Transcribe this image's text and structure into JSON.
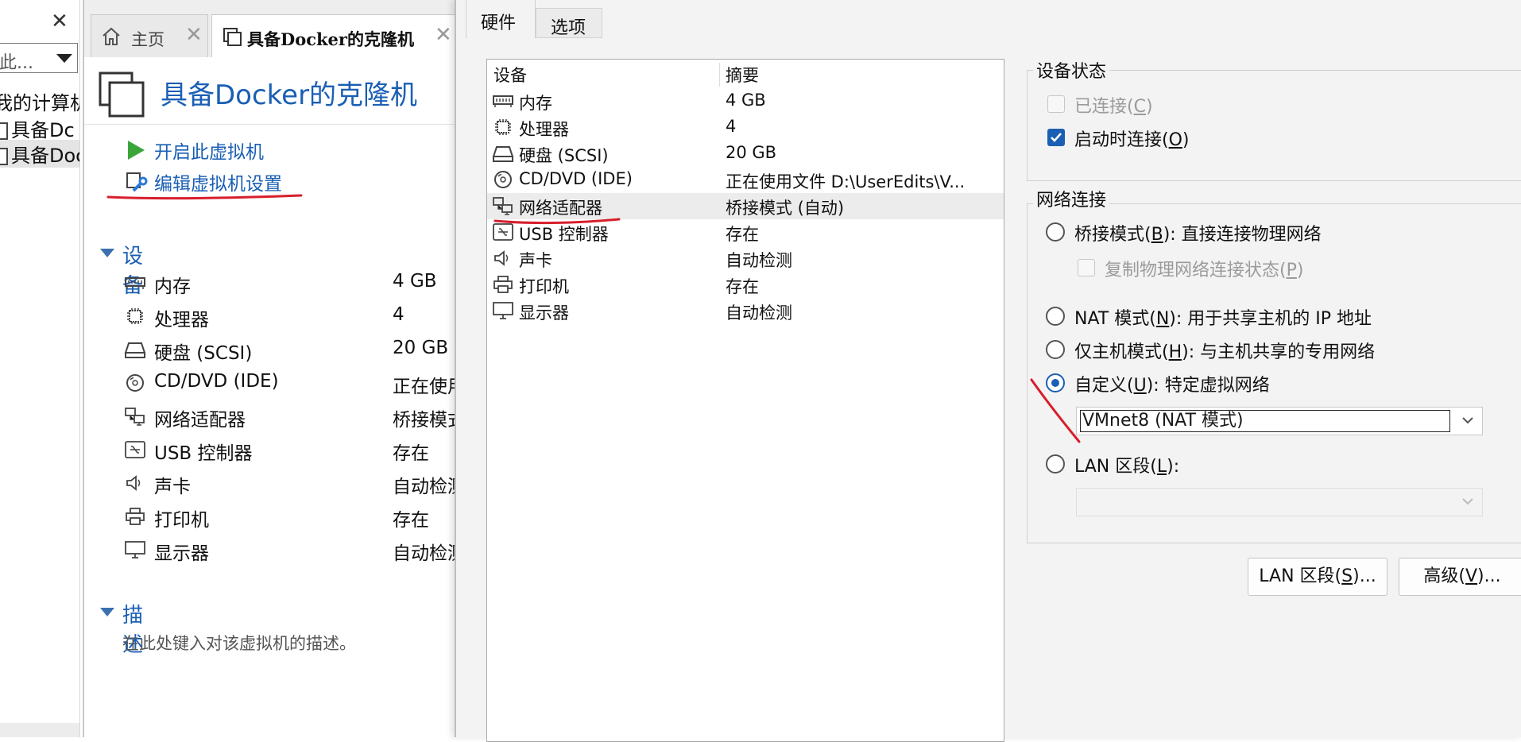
{
  "library": {
    "search_text": "此...",
    "root_label": "我的计算机",
    "items": [
      "具备Dc",
      "具备Doc"
    ]
  },
  "tabs": [
    {
      "label": "主页"
    },
    {
      "label": "具备Docker的克隆机"
    }
  ],
  "vm": {
    "title": "具备Docker的克隆机",
    "actions": {
      "power_on": "开启此虚拟机",
      "edit_settings": "编辑虚拟机设置"
    },
    "devices_header": "设备",
    "devices": [
      {
        "icon": "memory-icon",
        "name": "内存",
        "value": "4 GB"
      },
      {
        "icon": "cpu-icon",
        "name": "处理器",
        "value": "4"
      },
      {
        "icon": "disk-icon",
        "name": "硬盘 (SCSI)",
        "value": "20 GB"
      },
      {
        "icon": "cd-icon",
        "name": "CD/DVD (IDE)",
        "value": "正在使用"
      },
      {
        "icon": "network-icon",
        "name": "网络适配器",
        "value": "桥接模式"
      },
      {
        "icon": "usb-icon",
        "name": "USB 控制器",
        "value": "存在"
      },
      {
        "icon": "speaker-icon",
        "name": "声卡",
        "value": "自动检测"
      },
      {
        "icon": "printer-icon",
        "name": "打印机",
        "value": "存在"
      },
      {
        "icon": "display-icon",
        "name": "显示器",
        "value": "自动检测"
      }
    ],
    "description_header": "描述",
    "description_placeholder": "在此处键入对该虚拟机的描述。"
  },
  "dialog": {
    "tabs": {
      "hardware": "硬件",
      "options": "选项"
    },
    "list_headers": {
      "device": "设备",
      "summary": "摘要"
    },
    "hardware": [
      {
        "icon": "memory-icon",
        "name": "内存",
        "summary": "4 GB"
      },
      {
        "icon": "cpu-icon",
        "name": "处理器",
        "summary": "4"
      },
      {
        "icon": "disk-icon",
        "name": "硬盘 (SCSI)",
        "summary": "20 GB"
      },
      {
        "icon": "cd-icon",
        "name": "CD/DVD (IDE)",
        "summary": "正在使用文件 D:\\UserEdits\\V..."
      },
      {
        "icon": "network-icon",
        "name": "网络适配器",
        "summary": "桥接模式 (自动)",
        "selected": true
      },
      {
        "icon": "usb-icon",
        "name": "USB 控制器",
        "summary": "存在"
      },
      {
        "icon": "speaker-icon",
        "name": "声卡",
        "summary": "自动检测"
      },
      {
        "icon": "printer-icon",
        "name": "打印机",
        "summary": "存在"
      },
      {
        "icon": "display-icon",
        "name": "显示器",
        "summary": "自动检测"
      }
    ],
    "device_status": {
      "title": "设备状态",
      "connected": {
        "text": "已连接(",
        "key": "C",
        "tail": ")",
        "checked": false,
        "disabled": true
      },
      "connect_at_power_on": {
        "text": "启动时连接(",
        "key": "O",
        "tail": ")",
        "checked": true
      }
    },
    "network": {
      "title": "网络连接",
      "bridged": {
        "text": "桥接模式(",
        "key": "B",
        "tail": "): 直接连接物理网络",
        "selected": false
      },
      "replicate": {
        "text": "复制物理网络连接状态(",
        "key": "P",
        "tail": ")",
        "checked": false,
        "disabled": true
      },
      "nat": {
        "text": "NAT 模式(",
        "key": "N",
        "tail": "): 用于共享主机的 IP 地址",
        "selected": false
      },
      "host_only": {
        "text": "仅主机模式(",
        "key": "H",
        "tail": "): 与主机共享的专用网络",
        "selected": false
      },
      "custom": {
        "text": "自定义(",
        "key": "U",
        "tail": "): 特定虚拟网络",
        "selected": true
      },
      "custom_network_value": "VMnet8 (NAT 模式)",
      "lan_segment": {
        "text": "LAN 区段(",
        "key": "L",
        "tail": "):",
        "selected": false
      },
      "lan_segment_value": ""
    },
    "buttons": {
      "lan_segments": {
        "text": "LAN 区段(",
        "key": "S",
        "tail": ")..."
      },
      "advanced": {
        "text": "高级(",
        "key": "V",
        "tail": ")..."
      }
    }
  },
  "colors": {
    "accent": "#1a5fb4",
    "annotation_red": "#d81e2c",
    "power_green": "#3aa63a"
  }
}
